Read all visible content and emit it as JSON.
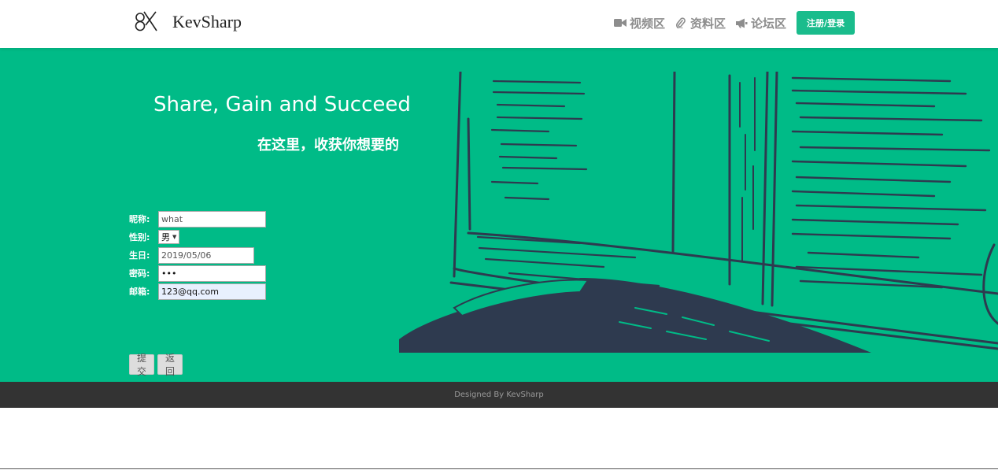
{
  "header": {
    "brand": "KevSharp",
    "nav": [
      {
        "label": "视频区",
        "icon": "video-icon"
      },
      {
        "label": "资料区",
        "icon": "paperclip-icon"
      },
      {
        "label": "论坛区",
        "icon": "bullhorn-icon"
      }
    ],
    "login_label": "注册/登录"
  },
  "hero": {
    "title": "Share, Gain and Succeed",
    "subtitle": "在这里，收获你想要的"
  },
  "form": {
    "nickname_label": "昵称:",
    "nickname_value": "what",
    "gender_label": "性别:",
    "gender_value": "男",
    "birthday_label": "生日:",
    "birthday_value": "2019/05/06",
    "password_label": "密码:",
    "password_value": "•••",
    "email_label": "邮箱:",
    "email_value": "123@qq.com",
    "submit_label": "提交",
    "back_label": "返回"
  },
  "footer": {
    "text": "Designed By KevSharp"
  },
  "colors": {
    "accent": "#1abc8c",
    "hero_bg": "#00bb87",
    "footer_bg": "#333333",
    "illustration_ink": "#2e3a4f"
  }
}
